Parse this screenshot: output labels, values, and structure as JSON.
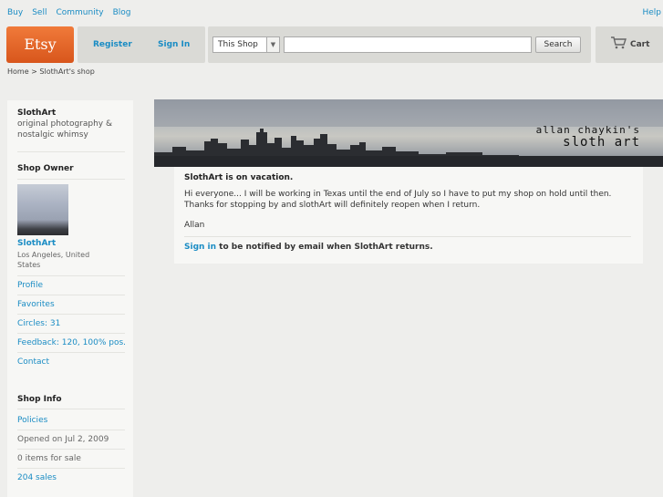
{
  "top_nav": {
    "buy": "Buy",
    "sell": "Sell",
    "community": "Community",
    "blog": "Blog",
    "help": "Help"
  },
  "header": {
    "logo": "Etsy",
    "register": "Register",
    "sign_in": "Sign In",
    "scope": "This Shop",
    "search_value": "",
    "search_button": "Search",
    "cart": "Cart"
  },
  "breadcrumb": "Home > SlothArt's shop",
  "sidebar": {
    "shop_name": "SlothArt",
    "tagline": "original photography & nostalgic whimsy",
    "owner_heading": "Shop Owner",
    "owner_name": "SlothArt",
    "owner_location": "Los Angeles, United States",
    "owner_links": [
      "Profile",
      "Favorites",
      "Circles: 31",
      "Feedback: 120, 100% pos.",
      "Contact"
    ],
    "info_heading": "Shop Info",
    "policies": "Policies",
    "opened": "Opened on Jul 2, 2009",
    "items_for_sale": "0 items for sale",
    "sales": "204 sales"
  },
  "banner": {
    "line1": "allan chaykin's",
    "line2": "sloth art"
  },
  "vacation": {
    "title": "SlothArt is on vacation.",
    "message": "Hi everyone... I will be working in Texas until the end of July so I have to put my shop on hold until then. Thanks for stopping by and slothArt will definitely reopen when I return.",
    "signature": "Allan",
    "sign_in_link": "Sign in",
    "notify_text": " to be notified by email when SlothArt returns."
  },
  "colors": {
    "accent": "#1a8cc4",
    "logo": "#e8692d",
    "background": "#eeeeec"
  }
}
